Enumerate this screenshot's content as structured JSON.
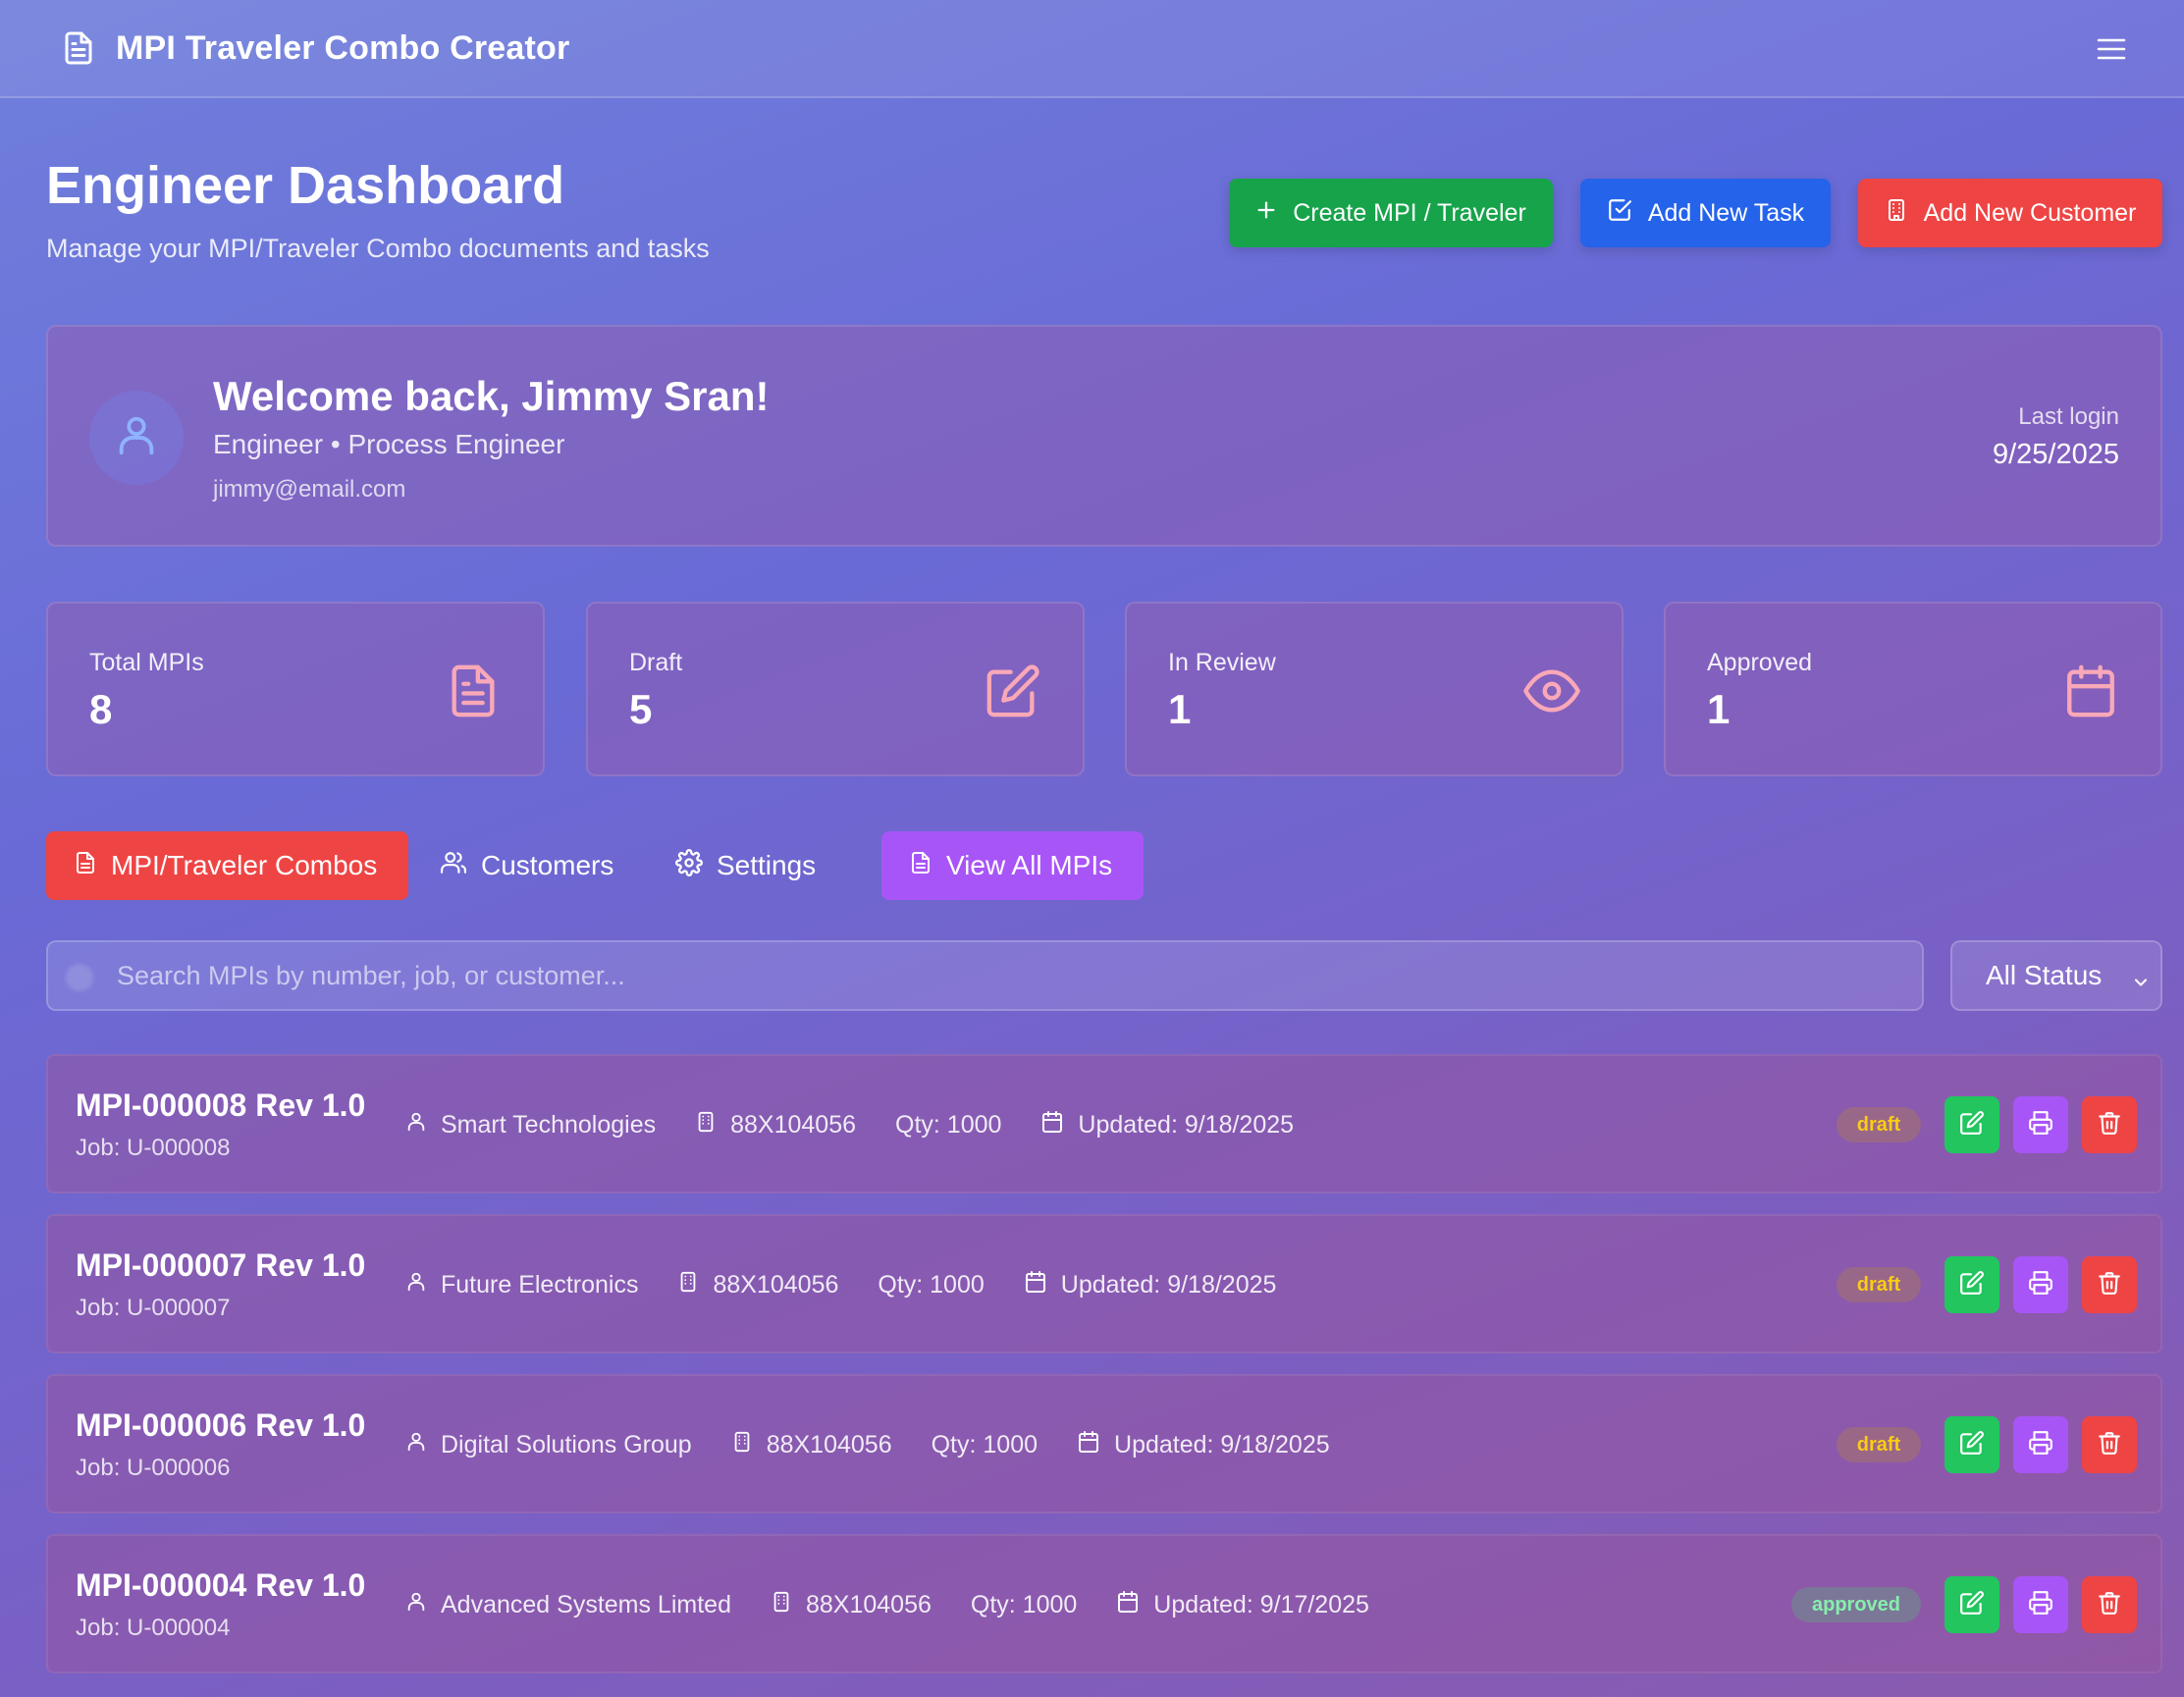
{
  "app": {
    "title": "MPI Traveler Combo Creator",
    "logo_icon": "document-icon",
    "menu_icon": "hamburger-menu-icon"
  },
  "header": {
    "title": "Engineer Dashboard",
    "subtitle": "Manage your MPI/Traveler Combo documents and tasks",
    "buttons": {
      "create": "Create MPI / Traveler",
      "add_task": "Add New Task",
      "add_customer": "Add New Customer"
    }
  },
  "welcome": {
    "greeting": "Welcome back, Jimmy Sran!",
    "role": "Engineer • Process Engineer",
    "email": "jimmy@email.com",
    "last_login_label": "Last login",
    "last_login_date": "9/25/2025"
  },
  "stats": [
    {
      "label": "Total MPIs",
      "value": "8",
      "icon": "document-icon"
    },
    {
      "label": "Draft",
      "value": "5",
      "icon": "edit-icon"
    },
    {
      "label": "In Review",
      "value": "1",
      "icon": "eye-icon"
    },
    {
      "label": "Approved",
      "value": "1",
      "icon": "calendar-icon"
    }
  ],
  "tabs": {
    "combos": "MPI/Traveler Combos",
    "customers": "Customers",
    "settings": "Settings",
    "view_all": "View All MPIs"
  },
  "search": {
    "placeholder": "Search MPIs by number, job, or customer...",
    "value": ""
  },
  "status_filter": {
    "selected": "All Status"
  },
  "mpis": [
    {
      "title": "MPI-000008 Rev 1.0",
      "job": "Job: U-000008",
      "customer": "Smart Technologies",
      "part": "88X104056",
      "qty": "Qty: 1000",
      "updated": "Updated: 9/18/2025",
      "status": "draft"
    },
    {
      "title": "MPI-000007 Rev 1.0",
      "job": "Job: U-000007",
      "customer": "Future Electronics",
      "part": "88X104056",
      "qty": "Qty: 1000",
      "updated": "Updated: 9/18/2025",
      "status": "draft"
    },
    {
      "title": "MPI-000006 Rev 1.0",
      "job": "Job: U-000006",
      "customer": "Digital Solutions Group",
      "part": "88X104056",
      "qty": "Qty: 1000",
      "updated": "Updated: 9/18/2025",
      "status": "draft"
    },
    {
      "title": "MPI-000004 Rev 1.0",
      "job": "Job: U-000004",
      "customer": "Advanced Systems Limted",
      "part": "88X104056",
      "qty": "Qty: 1000",
      "updated": "Updated: 9/17/2025",
      "status": "approved"
    }
  ],
  "colors": {
    "create_button": "#16a34a",
    "task_button": "#2563eb",
    "customer_button": "#ef4444",
    "active_tab": "#ef4444",
    "view_all_tab": "#a855f7",
    "stat_icon": "#f9a8b8",
    "edit_action": "#22c55e",
    "print_action": "#a855f7",
    "delete_action": "#ef4444"
  }
}
